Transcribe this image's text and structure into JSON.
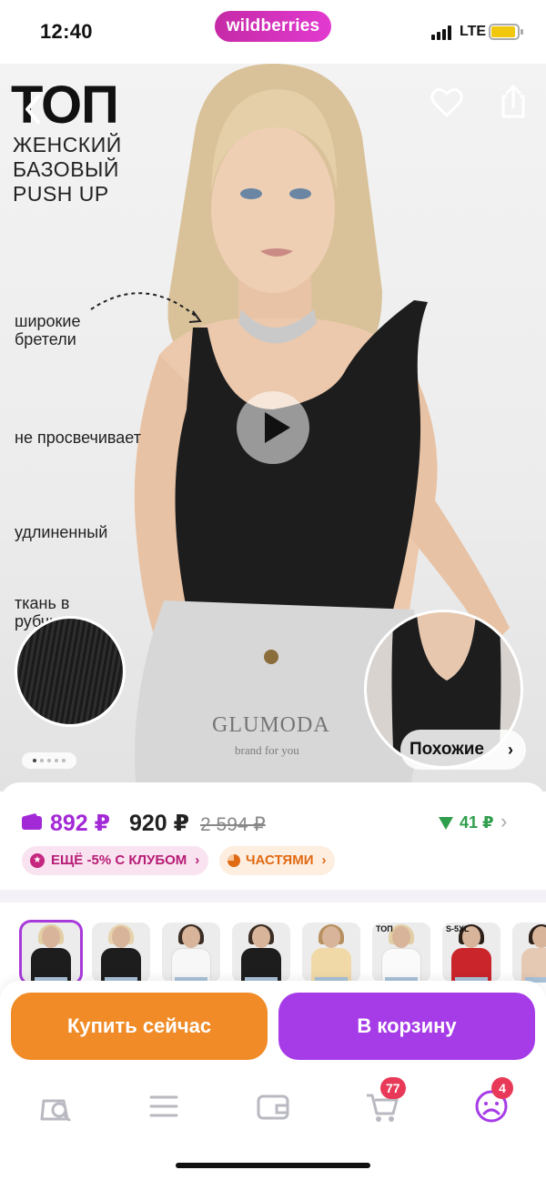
{
  "status_bar": {
    "time": "12:40",
    "store_pill": "wildberries",
    "network": "LTE",
    "battery_level": 0.85,
    "battery_color": "#f2c80f"
  },
  "hero": {
    "title": "ТОП",
    "subtitle": "ЖЕНСКИЙ\nБАЗОВЫЙ\nPUSH UP",
    "features": [
      "широкие\nбретели",
      "не просвечивает",
      "удлиненный",
      "ткань в\nрубчик"
    ],
    "brand": "GLUMODA",
    "brand_tagline": "brand for you",
    "similar_button": "Похожие",
    "image_count": 5,
    "current_image_index": 0,
    "icons": {
      "back": "chevron-left-icon",
      "favorite": "heart-icon",
      "share": "share-icon",
      "play": "play-icon"
    }
  },
  "price": {
    "wallet_price": "892 ₽",
    "regular_price": "920 ₽",
    "old_price": "2 594 ₽",
    "price_drop": "41 ₽",
    "wallet_color": "#a329d6",
    "drop_color": "#2f9e4c",
    "club_badge": "ЕЩЁ -5% С КЛУБОМ",
    "installments_badge": "ЧАСТЯМИ"
  },
  "thumbnails": {
    "selected_index": 0,
    "items": [
      {
        "color": "#1d1d1d",
        "hair": "#e3cfa6",
        "label": ""
      },
      {
        "color": "#1d1d1d",
        "hair": "#e6d3ad",
        "label": ""
      },
      {
        "color": "#f7f7f7",
        "hair": "#3b2d23",
        "label": ""
      },
      {
        "color": "#1d1d1d",
        "hair": "#3b2d23",
        "label": ""
      },
      {
        "color": "#f1d9a7",
        "hair": "#b88f5e",
        "label": ""
      },
      {
        "color": "#fafafa",
        "hair": "#e3cfa6",
        "label": "ТОП"
      },
      {
        "color": "#c9252b",
        "hair": "#2b1f18",
        "label": "S-5XL"
      },
      {
        "color": "#e6c9b3",
        "hair": "#2b1f18",
        "label": ""
      }
    ]
  },
  "actions": {
    "buy_now": "Купить сейчас",
    "add_to_cart": "В корзину",
    "buy_color": "#f08b27",
    "cart_color": "#a63ce7"
  },
  "tab_bar": {
    "items": [
      {
        "icon": "search-bag-icon"
      },
      {
        "icon": "catalog-menu-icon"
      },
      {
        "icon": "wallet-icon"
      },
      {
        "icon": "cart-icon",
        "badge": "77"
      },
      {
        "icon": "profile-icon",
        "badge": "4"
      }
    ]
  }
}
